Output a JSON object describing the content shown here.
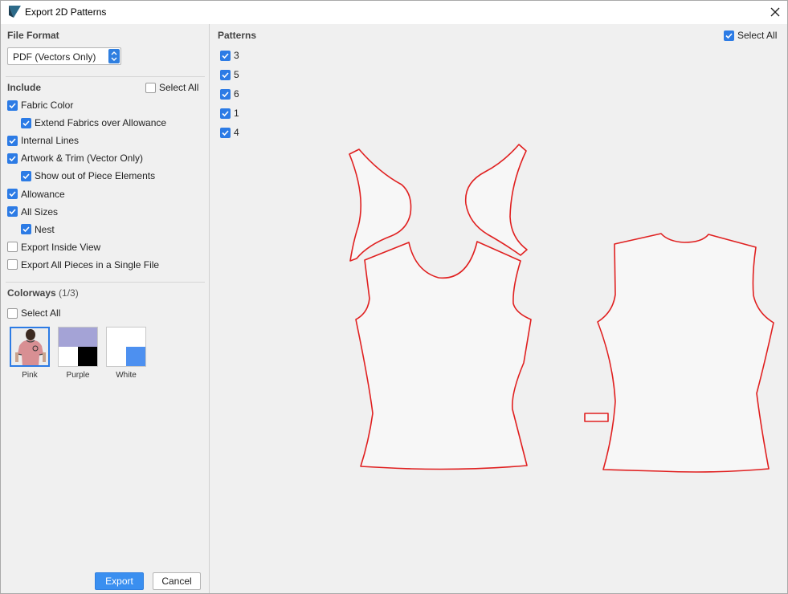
{
  "window": {
    "title": "Export 2D Patterns"
  },
  "left": {
    "file_format": {
      "title": "File Format",
      "selected": "PDF (Vectors Only)"
    },
    "include": {
      "title": "Include",
      "select_all": {
        "label": "Select All",
        "checked": false
      },
      "options": [
        {
          "label": "Fabric Color",
          "checked": true,
          "indent": 0
        },
        {
          "label": "Extend Fabrics over Allowance",
          "checked": true,
          "indent": 1
        },
        {
          "label": "Internal Lines",
          "checked": true,
          "indent": 0
        },
        {
          "label": "Artwork & Trim (Vector Only)",
          "checked": true,
          "indent": 0
        },
        {
          "label": "Show out of Piece Elements",
          "checked": true,
          "indent": 1
        },
        {
          "label": "Allowance",
          "checked": true,
          "indent": 0
        },
        {
          "label": "All Sizes",
          "checked": true,
          "indent": 0
        },
        {
          "label": "Nest",
          "checked": true,
          "indent": 1
        },
        {
          "label": "Export Inside View",
          "checked": false,
          "indent": 0
        },
        {
          "label": "Export All Pieces in a Single File",
          "checked": false,
          "indent": 0
        }
      ]
    },
    "colorways": {
      "title": "Colorways",
      "count": "(1/3)",
      "select_all": {
        "label": "Select All",
        "checked": false
      },
      "items": [
        {
          "label": "Pink",
          "selected": true
        },
        {
          "label": "Purple",
          "selected": false
        },
        {
          "label": "White",
          "selected": false
        }
      ]
    },
    "buttons": {
      "export": "Export",
      "cancel": "Cancel"
    }
  },
  "patterns": {
    "title": "Patterns",
    "select_all": {
      "label": "Select All",
      "checked": true
    },
    "items": [
      {
        "label": "3",
        "checked": true
      },
      {
        "label": "5",
        "checked": true
      },
      {
        "label": "6",
        "checked": true
      },
      {
        "label": "1",
        "checked": true
      },
      {
        "label": "4",
        "checked": true
      }
    ]
  },
  "colors": {
    "accent": "#2c7be5",
    "pattern_stroke": "#e02020",
    "pattern_fill": "#f7f7f7",
    "purple_swatch": "#a4a3d6",
    "white_swatch_accent": "#4d90f0"
  }
}
